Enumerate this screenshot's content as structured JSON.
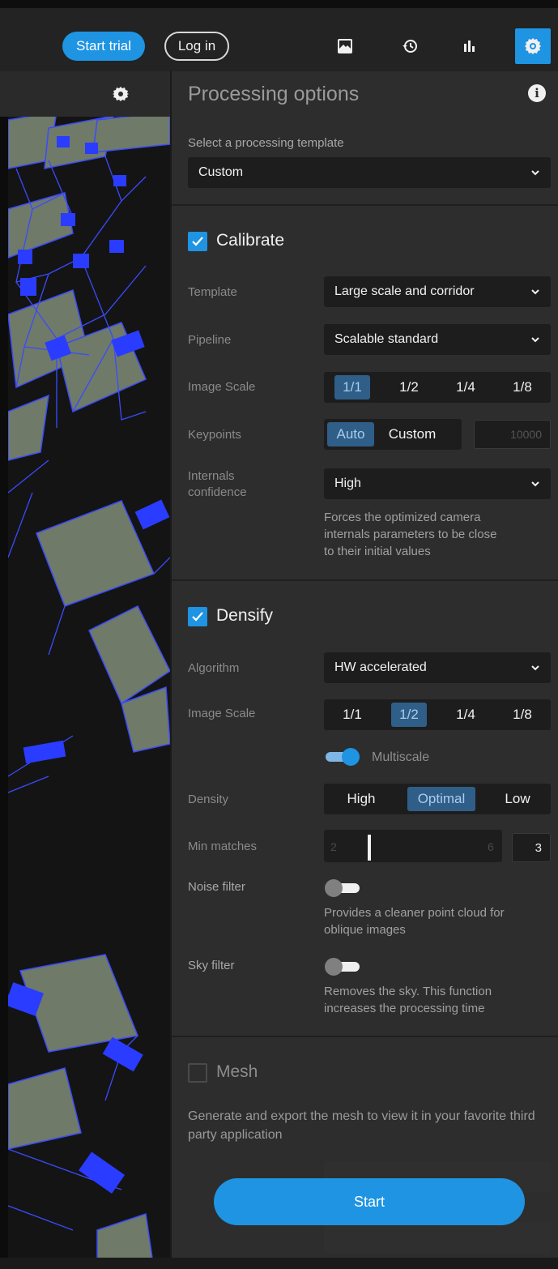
{
  "topbar": {
    "start_trial": "Start trial",
    "log_in": "Log in",
    "icons": [
      "images-icon",
      "history-icon",
      "chart-icon",
      "settings-icon"
    ],
    "accent": "#1e94e2"
  },
  "panel": {
    "title": "Processing options",
    "template_label": "Select a processing template",
    "template_value": "Custom"
  },
  "calibrate": {
    "title": "Calibrate",
    "checked": true,
    "template_label": "Template",
    "template_value": "Large scale and corridor",
    "pipeline_label": "Pipeline",
    "pipeline_value": "Scalable standard",
    "image_scale_label": "Image Scale",
    "image_scales": [
      "1/1",
      "1/2",
      "1/4",
      "1/8"
    ],
    "image_scale_selected": "1/1",
    "keypoints_label": "Keypoints",
    "keypoints_options": [
      "Auto",
      "Custom"
    ],
    "keypoints_selected": "Auto",
    "keypoints_value": "10000",
    "internals_label_1": "Internals",
    "internals_label_2": "confidence",
    "internals_value": "High",
    "internals_help_1": "Forces the optimized camera",
    "internals_help_2": "internals parameters to be close",
    "internals_help_3": "to their initial values"
  },
  "densify": {
    "title": "Densify",
    "checked": true,
    "algorithm_label": "Algorithm",
    "algorithm_value": "HW accelerated",
    "image_scale_label": "Image Scale",
    "image_scales": [
      "1/1",
      "1/2",
      "1/4",
      "1/8"
    ],
    "image_scale_selected": "1/2",
    "multiscale_label": "Multiscale",
    "multiscale_on": true,
    "density_label": "Density",
    "density_options": [
      "High",
      "Optimal",
      "Low"
    ],
    "density_selected": "Optimal",
    "min_matches_label": "Min matches",
    "min_matches_min": "2",
    "min_matches_max": "6",
    "min_matches_value": "3",
    "noise_filter_label": "Noise filter",
    "noise_filter_on": false,
    "noise_help_1": "Provides a cleaner point cloud for",
    "noise_help_2": "oblique images",
    "sky_filter_label": "Sky filter",
    "sky_filter_on": false,
    "sky_help_1": "Removes the sky. This function",
    "sky_help_2": "increases the processing time"
  },
  "mesh": {
    "title": "Mesh",
    "checked": false,
    "description": "Generate and export the mesh to view it in your favorite third party application"
  },
  "start_label": "Start"
}
